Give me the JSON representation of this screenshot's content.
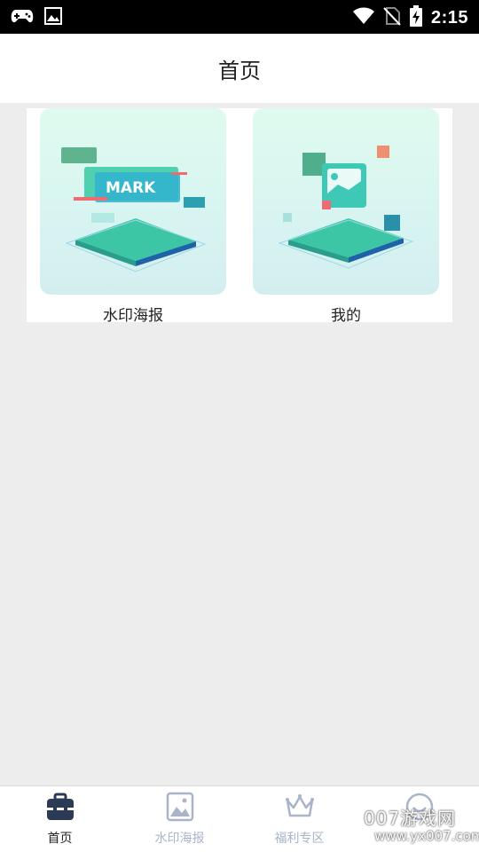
{
  "status_bar": {
    "time": "2:15",
    "left_icons": [
      "gamepad-icon",
      "image-icon"
    ],
    "right_icons": [
      "wifi-icon",
      "no-sim-icon",
      "battery-charging-icon"
    ]
  },
  "header": {
    "title": "首页"
  },
  "grid": {
    "items": [
      {
        "label": "水印海报",
        "thumb_text": "MARK"
      },
      {
        "label": "我的"
      }
    ]
  },
  "bottom_nav": {
    "items": [
      {
        "label": "首页",
        "icon": "toolbox-icon",
        "active": true
      },
      {
        "label": "水印海报",
        "icon": "image-icon",
        "active": false
      },
      {
        "label": "福利专区",
        "icon": "crown-icon",
        "active": false
      },
      {
        "label": "",
        "icon": "smile-icon",
        "active": false
      }
    ]
  },
  "watermark": {
    "text": "007游戏网",
    "url": "www.yx007.com"
  },
  "colors": {
    "accent": "#2c3b55",
    "inactive": "#a9b4c8",
    "background": "#ededed"
  }
}
